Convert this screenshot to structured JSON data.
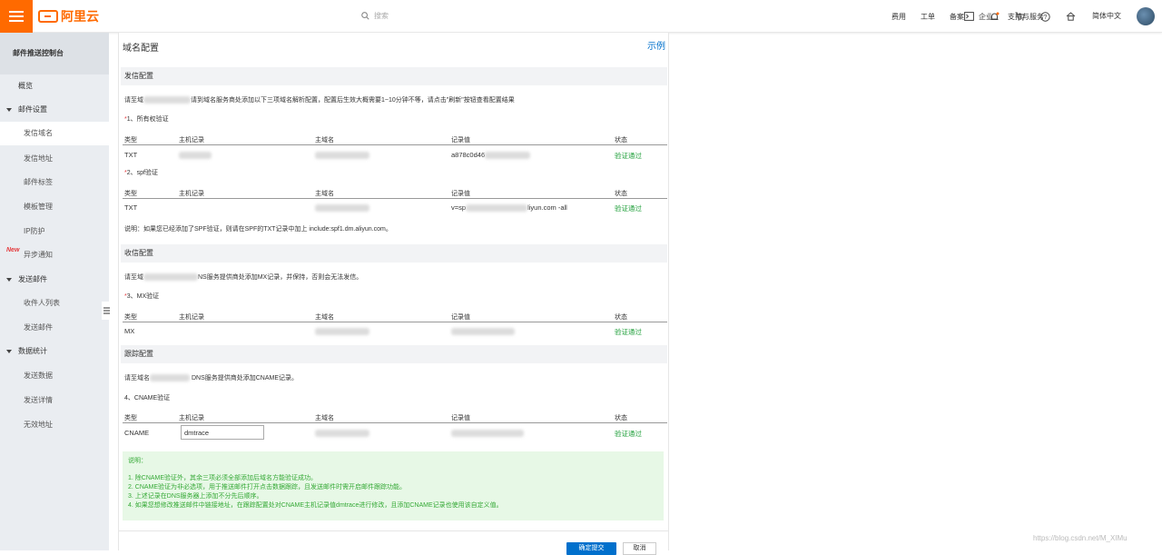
{
  "topbar": {
    "logo_text": "阿里云",
    "search_placeholder": "搜索",
    "nav": [
      "费用",
      "工单",
      "备案",
      "企业",
      "支持与服务"
    ],
    "language": "简体中文",
    "brand_color": "#ff6a00"
  },
  "sidebar": {
    "title": "邮件推送控制台",
    "new_badge": "New",
    "items": [
      {
        "label": "概览",
        "level": 1
      },
      {
        "label": "邮件设置",
        "level": 1,
        "group": true
      },
      {
        "label": "发信域名",
        "level": 2,
        "active": true
      },
      {
        "label": "发信地址",
        "level": 2
      },
      {
        "label": "邮件标签",
        "level": 2
      },
      {
        "label": "模板管理",
        "level": 2
      },
      {
        "label": "IP防护",
        "level": 2
      },
      {
        "label": "异步通知",
        "level": 2
      },
      {
        "label": "发送邮件",
        "level": 1,
        "group": true
      },
      {
        "label": "收件人列表",
        "level": 2
      },
      {
        "label": "发送邮件",
        "level": 2
      },
      {
        "label": "数据统计",
        "level": 1,
        "group": true
      },
      {
        "label": "发送数据",
        "level": 2
      },
      {
        "label": "发送详情",
        "level": 2
      },
      {
        "label": "无效地址",
        "level": 2
      }
    ]
  },
  "main": {
    "title": "域名配置",
    "example_link": "示例",
    "send_section": {
      "title": "发信配置",
      "instruction_pre": "请至域",
      "instruction_post": "请到域名服务商处添加以下三项域名解析配置，配置后生效大概需要1~10分钟不等，请点击\"刷新\"按钮查看配置结果",
      "ownership_label": "1、所有权验证",
      "spf_label": "2、spf验证",
      "spf_note": "说明：如果您已经添加了SPF验证，则请在SPF的TXT记录中加上 include:spf1.dm.aliyun.com。"
    },
    "table_headers": {
      "type": "类型",
      "host": "主机记录",
      "domain": "主域名",
      "value": "记录值",
      "status": "状态"
    },
    "records": {
      "ownership": {
        "type": "TXT",
        "value": "a878c0d46",
        "status": "验证通过"
      },
      "spf": {
        "type": "TXT",
        "value_pre": "v=sp",
        "value_post": "liyun.com -all",
        "status": "验证通过"
      },
      "mx": {
        "type": "MX",
        "status": "验证通过"
      },
      "cname": {
        "type": "CNAME",
        "host_input": "dmtrace",
        "status": "验证通过"
      }
    },
    "receive_section": {
      "title": "收信配置",
      "instruction_pre": "请至域",
      "instruction_post": "NS服务提供商处添加MX记录，并保持，否则会无法发信。",
      "mx_label": "3、MX验证"
    },
    "track_section": {
      "title": "跟踪配置",
      "instruction_pre": "请至域名",
      "instruction_post": "DNS服务提供商处添加CNAME记录。",
      "cname_label": "4、CNAME验证"
    },
    "note_box": {
      "title": "说明：",
      "lines": [
        "1. 除CNAME验证外，其余三项必须全部添加后域名方能验证成功。",
        "2. CNAME验证为非必选项，用于推送邮件打开点击数据跟踪，且发送邮件时需开启邮件跟踪功能。",
        "3. 上述记录在DNS服务器上添加不分先后顺序。",
        "4. 如果您想修改推送邮件中链接地址，在跟踪配置处对CNAME主机记录值dmtrace进行修改，且添加CNAME记录也使用该自定义值。"
      ]
    },
    "buttons": {
      "save": "确定提交",
      "cancel": "取消"
    }
  },
  "watermark": "https://blog.csdn.net/M_XIMu",
  "colors": {
    "accent_blue": "#0070cc",
    "success_green": "#22a03c",
    "required_red": "#e4393c"
  }
}
